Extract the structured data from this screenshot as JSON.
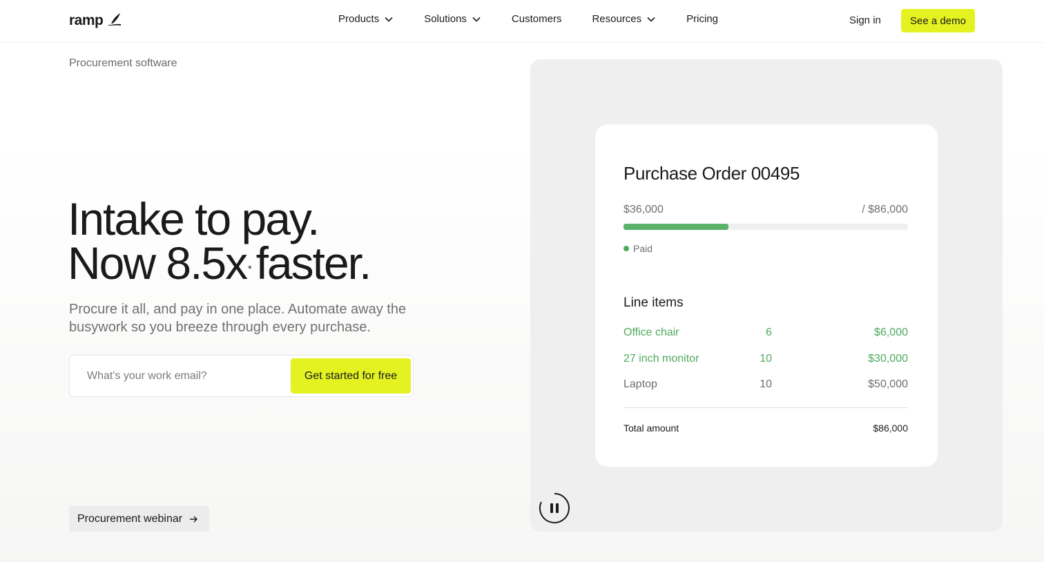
{
  "nav": {
    "logo_text": "ramp",
    "links": [
      {
        "label": "Products",
        "dropdown": true
      },
      {
        "label": "Solutions",
        "dropdown": true
      },
      {
        "label": "Customers",
        "dropdown": false
      },
      {
        "label": "Resources",
        "dropdown": true
      },
      {
        "label": "Pricing",
        "dropdown": false
      }
    ],
    "sign_in": "Sign in",
    "demo": "See a demo"
  },
  "hero": {
    "eyebrow": "Procurement software",
    "headline_line1": "Intake to pay.",
    "headline_line2_a": "Now 8.5x",
    "headline_sup": "*",
    "headline_line2_b": "faster.",
    "subtext": "Procure it all, and pay in one place. Automate away the busywork so you breeze through every purchase.",
    "email_placeholder": "What's your work email?",
    "cta": "Get started for free",
    "webinar": "Procurement webinar"
  },
  "po_card": {
    "title": "Purchase Order 00495",
    "paid_amount": "$36,000",
    "total_amount_label": "/ $86,000",
    "progress_fraction": 0.37,
    "status": "Paid",
    "line_items_title": "Line items",
    "line_items": [
      {
        "name": "Office chair",
        "qty": "6",
        "price": "$6,000",
        "state": "green"
      },
      {
        "name": "27 inch monitor",
        "qty": "10",
        "price": "$30,000",
        "state": "green"
      },
      {
        "name": "Laptop",
        "qty": "10",
        "price": "$50,000",
        "state": "grey"
      }
    ],
    "total_label": "Total amount",
    "total_value": "$86,000"
  },
  "colors": {
    "accent": "#e4f221",
    "success": "#4ea95e",
    "panel": "#efefef"
  },
  "icons": {
    "logo": "ramp-leaf-icon",
    "dropdown": "chevron-down-icon",
    "arrow": "arrow-right-icon",
    "pause": "pause-icon"
  }
}
